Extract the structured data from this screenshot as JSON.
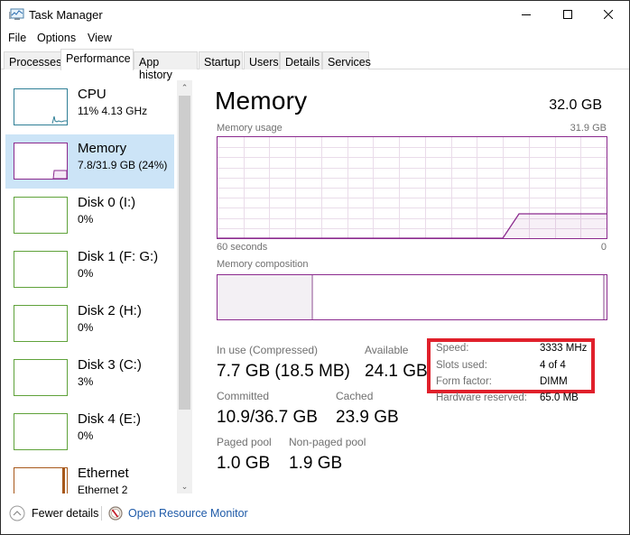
{
  "window": {
    "title": "Task Manager",
    "controls": {
      "minimize": "minimize",
      "maximize": "maximize",
      "close": "close"
    }
  },
  "menu": [
    "File",
    "Options",
    "View"
  ],
  "tabs": [
    {
      "label": "Processes",
      "active": false
    },
    {
      "label": "Performance",
      "active": true
    },
    {
      "label": "App history",
      "active": false
    },
    {
      "label": "Startup",
      "active": false
    },
    {
      "label": "Users",
      "active": false
    },
    {
      "label": "Details",
      "active": false
    },
    {
      "label": "Services",
      "active": false
    }
  ],
  "sidebar": {
    "items": [
      {
        "name": "CPU",
        "sub": "11% 4.13 GHz",
        "color": "#2f7f96",
        "selected": false
      },
      {
        "name": "Memory",
        "sub": "7.8/31.9 GB (24%)",
        "color": "#8b2a8e",
        "selected": true
      },
      {
        "name": "Disk 0 (I:)",
        "sub": "0%",
        "color": "#5fa23a",
        "selected": false
      },
      {
        "name": "Disk 1 (F: G:)",
        "sub": "0%",
        "color": "#5fa23a",
        "selected": false
      },
      {
        "name": "Disk 2 (H:)",
        "sub": "0%",
        "color": "#5fa23a",
        "selected": false
      },
      {
        "name": "Disk 3 (C:)",
        "sub": "3%",
        "color": "#5fa23a",
        "selected": false
      },
      {
        "name": "Disk 4 (E:)",
        "sub": "0%",
        "color": "#5fa23a",
        "selected": false
      },
      {
        "name": "Ethernet",
        "sub": "Ethernet 2",
        "color": "#a7581a",
        "selected": false
      }
    ]
  },
  "main": {
    "title": "Memory",
    "total": "32.0 GB",
    "usage_label": "Memory usage",
    "usage_max": "31.9 GB",
    "time_left": "60 seconds",
    "time_right": "0",
    "composition_label": "Memory composition",
    "stats": {
      "in_use_label": "In use (Compressed)",
      "in_use_value": "7.7 GB (18.5 MB)",
      "available_label": "Available",
      "available_value": "24.1 GB",
      "committed_label": "Committed",
      "committed_value": "10.9/36.7 GB",
      "cached_label": "Cached",
      "cached_value": "23.9 GB",
      "paged_label": "Paged pool",
      "paged_value": "1.0 GB",
      "nonpaged_label": "Non-paged pool",
      "nonpaged_value": "1.9 GB"
    },
    "info": {
      "speed_label": "Speed:",
      "speed_value": "3333 MHz",
      "slots_label": "Slots used:",
      "slots_value": "4 of 4",
      "form_label": "Form factor:",
      "form_value": "DIMM",
      "reserved_label": "Hardware reserved:",
      "reserved_value": "65.0 MB"
    }
  },
  "chart_data": {
    "type": "area",
    "title": "Memory usage",
    "xlabel": "60 seconds → 0",
    "ylabel": "",
    "ylim": [
      0,
      31.9
    ],
    "xlim": [
      60,
      0
    ],
    "grid": true,
    "series": [
      {
        "name": "In use (GB)",
        "x": [
          60,
          16,
          13.5,
          0
        ],
        "values": [
          0,
          0,
          7.7,
          7.7
        ]
      }
    ],
    "composition": {
      "in_use_fraction": 0.245,
      "standby_end_fraction": 0.995
    }
  },
  "footer": {
    "fewer_details": "Fewer details",
    "open_resource_monitor": "Open Resource Monitor"
  },
  "colors": {
    "memory": "#8b2a8e",
    "cpu": "#2f7f96",
    "disk": "#5fa23a",
    "ethernet": "#a7581a",
    "selected_bg": "#cce4f7",
    "highlight_box": "#e0202b",
    "link": "#1e5aa8"
  }
}
